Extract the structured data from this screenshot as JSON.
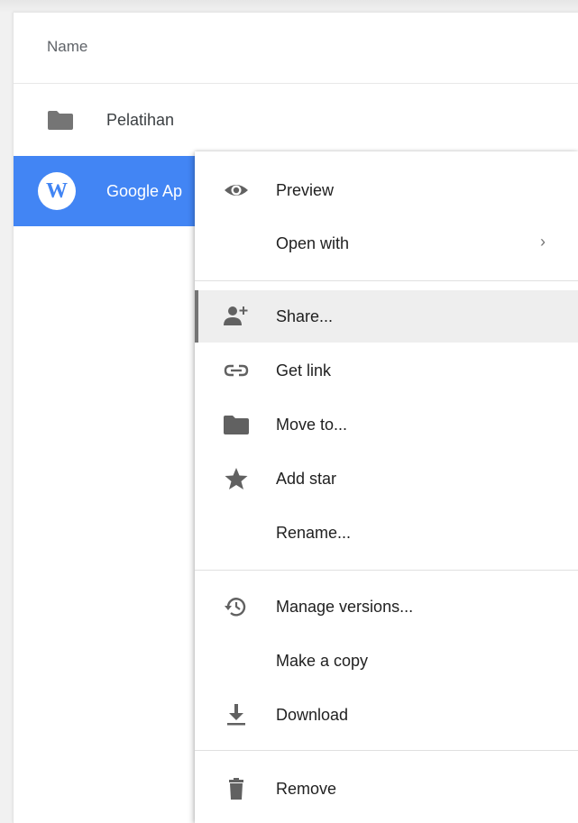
{
  "file_list": {
    "header": {
      "name_label": "Name"
    },
    "rows": [
      {
        "label": "Pelatihan",
        "icon": "folder-icon"
      },
      {
        "label": "Google Ap",
        "icon": "word-doc-icon",
        "avatar_letter": "W",
        "selected": true
      }
    ]
  },
  "context_menu": {
    "items": [
      {
        "label": "Preview",
        "icon": "eye-icon"
      },
      {
        "label": "Open with",
        "submenu_arrow": "›"
      },
      {
        "label": "Share...",
        "icon": "add-person-icon",
        "highlighted": true
      },
      {
        "label": "Get link",
        "icon": "link-icon"
      },
      {
        "label": "Move to...",
        "icon": "folder-icon"
      },
      {
        "label": "Add star",
        "icon": "star-icon"
      },
      {
        "label": "Rename..."
      },
      {
        "label": "Manage versions...",
        "icon": "history-icon"
      },
      {
        "label": "Make a copy"
      },
      {
        "label": "Download",
        "icon": "download-icon"
      },
      {
        "label": "Remove",
        "icon": "trash-icon"
      }
    ]
  },
  "colors": {
    "selection": "#4285f4",
    "icon_gray": "#616161",
    "highlight_bg": "#eeeeee"
  }
}
